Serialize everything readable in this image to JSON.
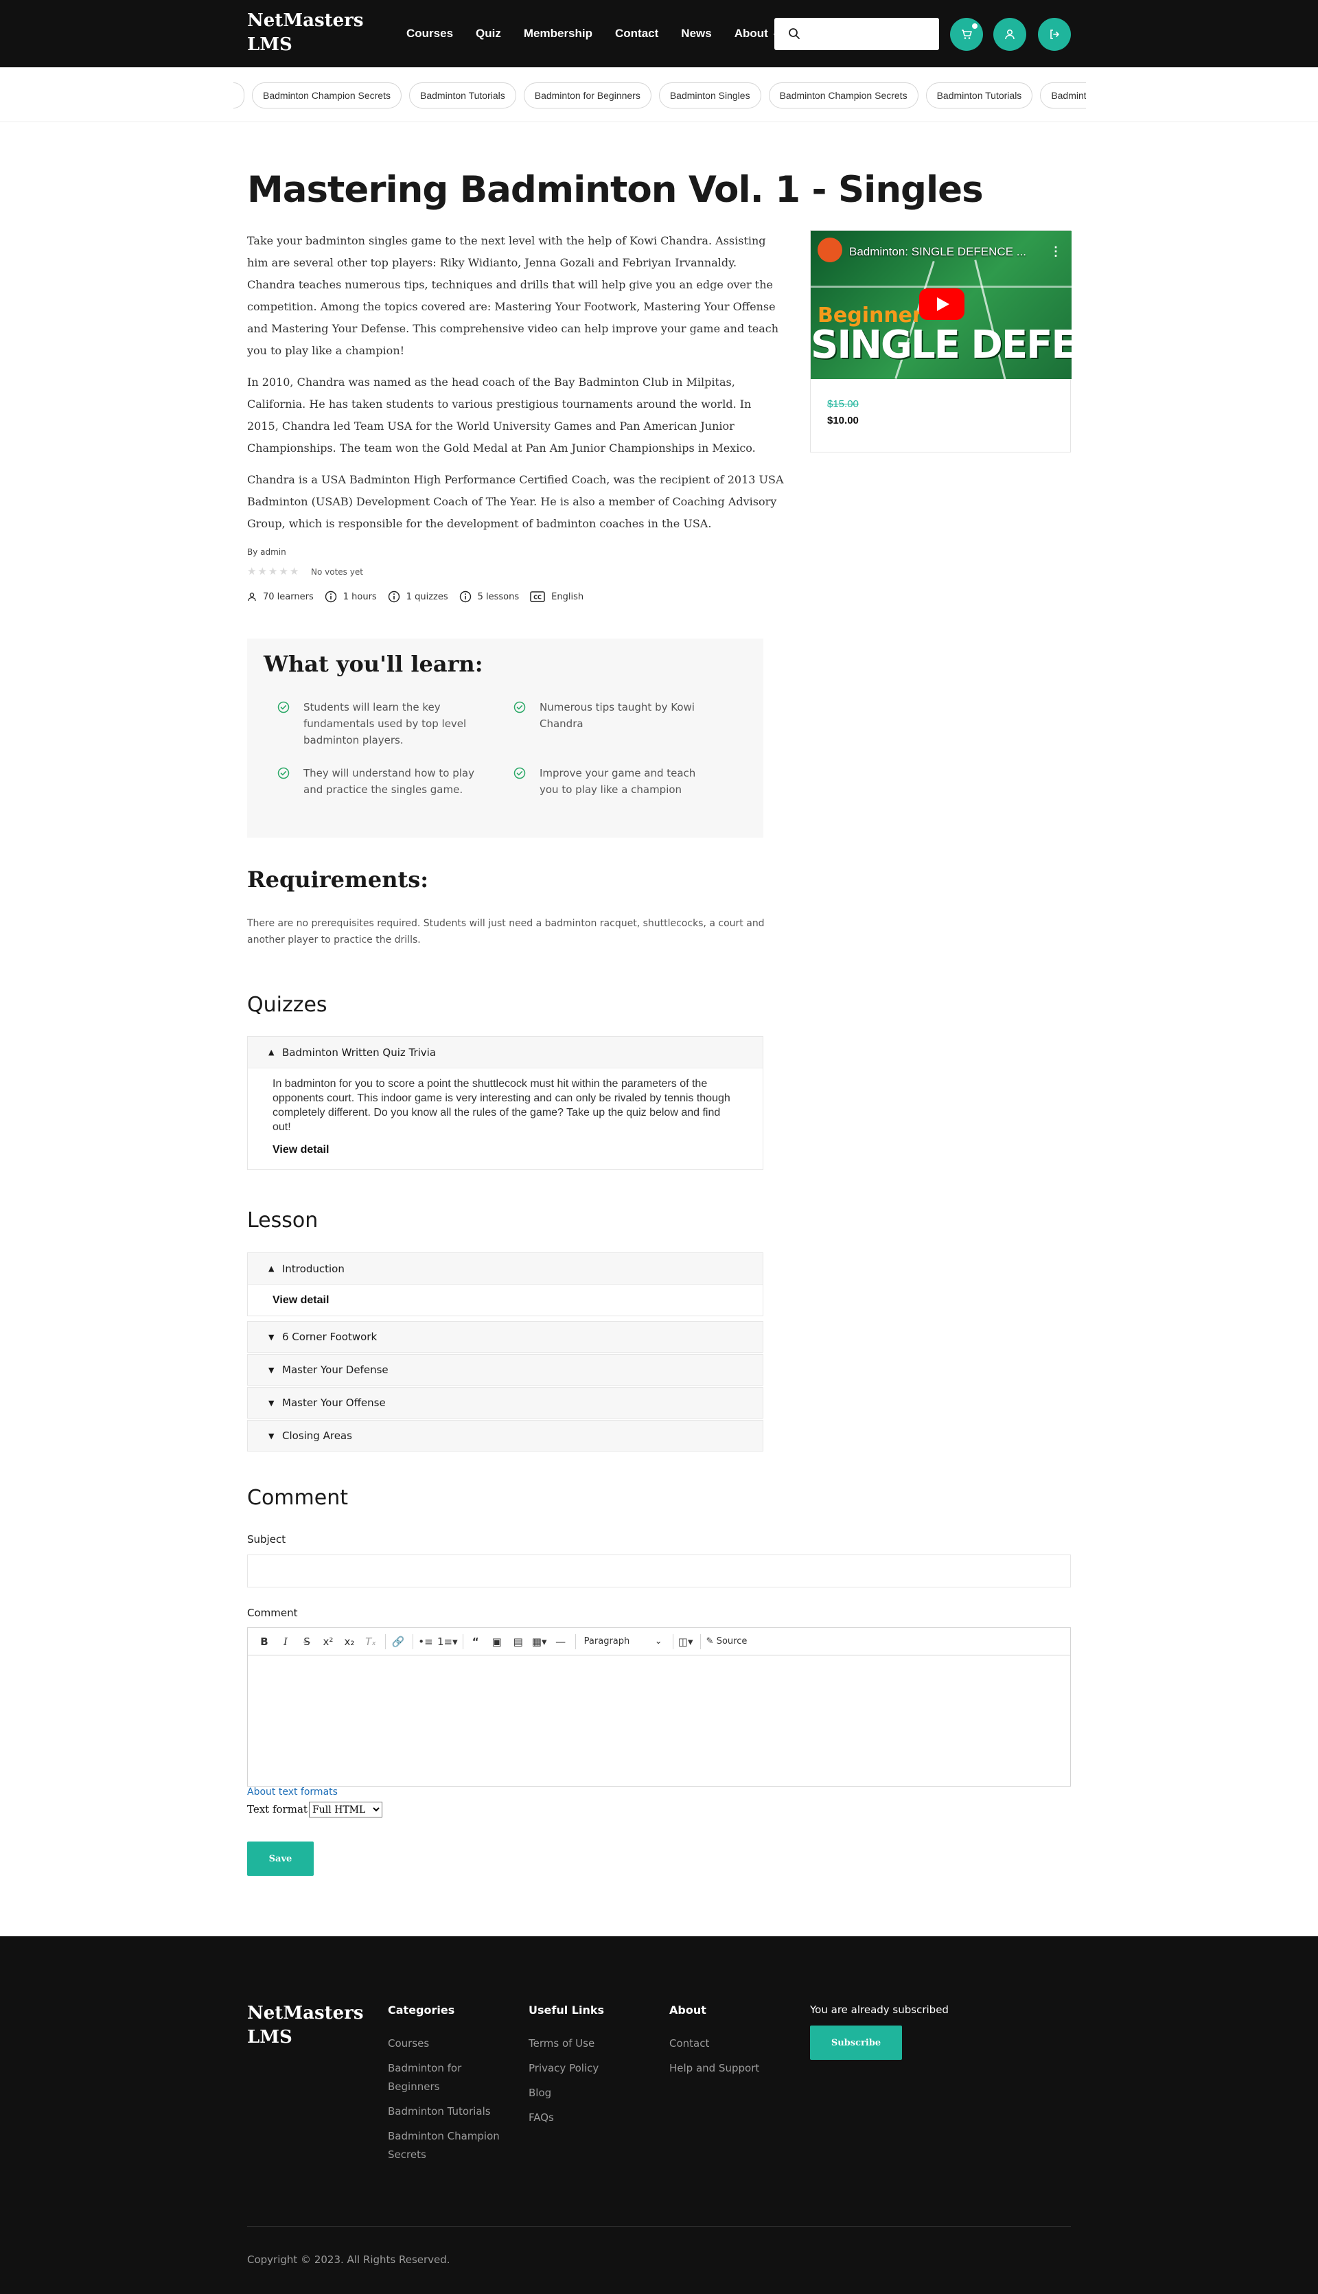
{
  "header": {
    "logo": "NetMasters LMS",
    "nav": [
      "Courses",
      "Quiz",
      "Membership",
      "Contact",
      "News",
      "About"
    ],
    "search_placeholder": "",
    "accent": "#1fb59c"
  },
  "tags": [
    "Badminton Champion Secrets",
    "Badminton Tutorials",
    "Badminton for Beginners",
    "Badminton Singles",
    "Badminton Champion Secrets",
    "Badminton Tutorials",
    "Badminton for Beginners"
  ],
  "course": {
    "title": "Mastering Badminton Vol. 1 - Singles",
    "paragraphs": [
      "Take your badminton singles game to the next level with the help of Kowi Chandra. Assisting him are several other top players: Riky Widianto, Jenna Gozali and Febriyan Irvannaldy. Chandra teaches numerous tips, techniques and drills that will help give you an edge over the competition. Among the topics covered are: Mastering Your Footwork, Mastering Your Offense and Mastering Your Defense. This comprehensive video can help improve your game and teach you to play like a champion!",
      "In 2010, Chandra was named as the head coach of the Bay Badminton Club in Milpitas, California. He has taken students to various prestigious tournaments around the world. In 2015, Chandra led Team USA for the World University Games and Pan American Junior Championships. The team won the Gold Medal at Pan Am Junior Championships in Mexico.",
      "Chandra is a USA Badminton High Performance Certified Coach, was the recipient of 2013 USA Badminton (USAB) Development Coach of The Year. He is also a member of Coaching Advisory Group, which is responsible for the development of badminton coaches in the USA."
    ],
    "author": "By  admin",
    "votes": "No votes yet",
    "stats": {
      "learners": "70 learners",
      "hours": "1 hours",
      "quizzes": "1 quizzes",
      "lessons": "5 lessons",
      "language": "English"
    }
  },
  "video": {
    "title": "Badminton: SINGLE DEFENCE ...",
    "overlay_small": "Beginner",
    "overlay_big": "SINGLE DEFENCE",
    "price_old": "$15.00",
    "price_new": "$10.00"
  },
  "learn": {
    "title": "What you'll learn:",
    "items": [
      "Students will learn the key fundamentals used by top level badminton players.",
      "Numerous tips taught by Kowi Chandra",
      "They will understand how to play and practice the singles game.",
      "Improve your game and teach you to play like a champion"
    ]
  },
  "requirements": {
    "title": "Requirements:",
    "text": "There are no prerequisites required. Students will just need a badminton racquet, shuttlecocks, a court and another player to practice the drills."
  },
  "quizzes": {
    "title": "Quizzes",
    "item_title": "Badminton Written Quiz Trivia",
    "item_desc": "In badminton for you to score a point the shuttlecock must hit within the parameters of the opponents court. This indoor game is very interesting and can only be rivaled by tennis though completely different. Do you know all the rules of the game? Take up the quiz below and find out!",
    "view_detail": "View detail"
  },
  "lesson": {
    "title": "Lesson",
    "items": [
      "Introduction",
      "6 Corner Footwork",
      "Master Your Defense",
      "Master Your Offense",
      "Closing Areas"
    ],
    "view_detail": "View detail"
  },
  "comment": {
    "title": "Comment",
    "subject_label": "Subject",
    "comment_label": "Comment",
    "paragraph": "Paragraph",
    "source": "Source",
    "about_formats": "About text formats",
    "text_format_label": "Text format",
    "text_format_value": "Full HTML",
    "save": "Save"
  },
  "footer": {
    "logo": "NetMasters LMS",
    "categories": {
      "title": "Categories",
      "links": [
        "Courses",
        "Badminton for Beginners",
        "Badminton Tutorials",
        "Badminton Champion Secrets"
      ]
    },
    "useful": {
      "title": "Useful Links",
      "links": [
        "Terms of Use",
        "Privacy Policy",
        "Blog",
        "FAQs"
      ]
    },
    "about": {
      "title": "About",
      "links": [
        "Contact",
        "Help and Support"
      ]
    },
    "subscribed": "You are already subscribed",
    "subscribe": "Subscribe",
    "copyright": "Copyright © 2023. All Rights Reserved."
  }
}
